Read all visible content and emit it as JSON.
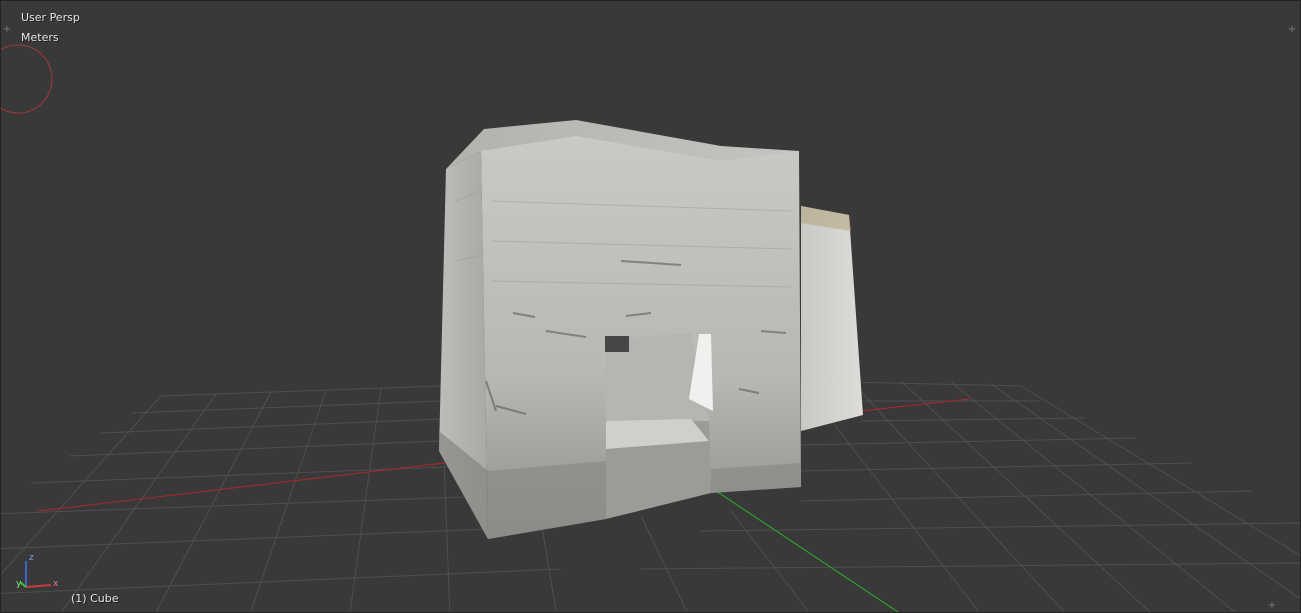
{
  "viewport": {
    "view_name": "User Persp",
    "units": "Meters",
    "active_object": "(1) Cube"
  },
  "axis_gizmo": {
    "x_label": "x",
    "y_label": "y",
    "z_label": "z"
  },
  "icons": {
    "corner_split": "corner-split-icon",
    "navigation_circle": "rotate-navigation-icon"
  },
  "colors": {
    "background": "#393939",
    "grid": "#4f4f4f",
    "x_axis": "#9b2c2c",
    "y_axis": "#2f9b2f",
    "text": "#e6e6e6"
  }
}
